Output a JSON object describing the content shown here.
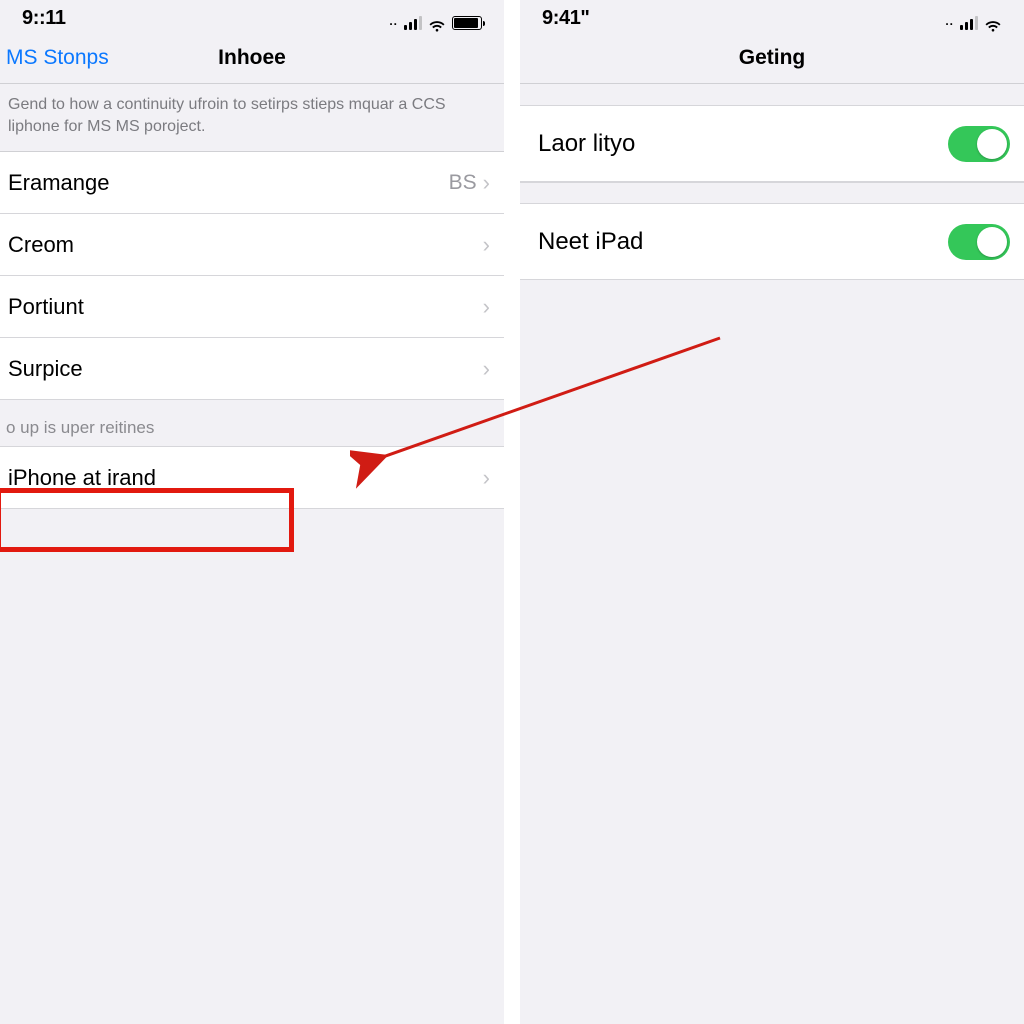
{
  "left": {
    "status": {
      "time": "9::11"
    },
    "nav": {
      "back": "MS Stonps",
      "title": "Inhoee"
    },
    "description": "Gend to how a continuity ufroin to setirps stieps mquar a CCS liphone for MS MS poroject.",
    "rows": [
      {
        "label": "Eramange",
        "value": "BS"
      },
      {
        "label": "Creom",
        "value": ""
      },
      {
        "label": "Portiunt",
        "value": ""
      },
      {
        "label": "Surpice",
        "value": ""
      }
    ],
    "section2": {
      "header": "o up is uper reitines",
      "row": {
        "label": "iPhone at irand"
      }
    }
  },
  "right": {
    "status": {
      "time": "9:41\""
    },
    "nav": {
      "title": "Geting"
    },
    "rows": [
      {
        "label": "Laor lityo",
        "on": true
      },
      {
        "label": "Neet iPad",
        "on": true
      }
    ]
  },
  "annotations": {
    "highlight_color": "#e2190f",
    "arrow_color": "#d01c14"
  }
}
